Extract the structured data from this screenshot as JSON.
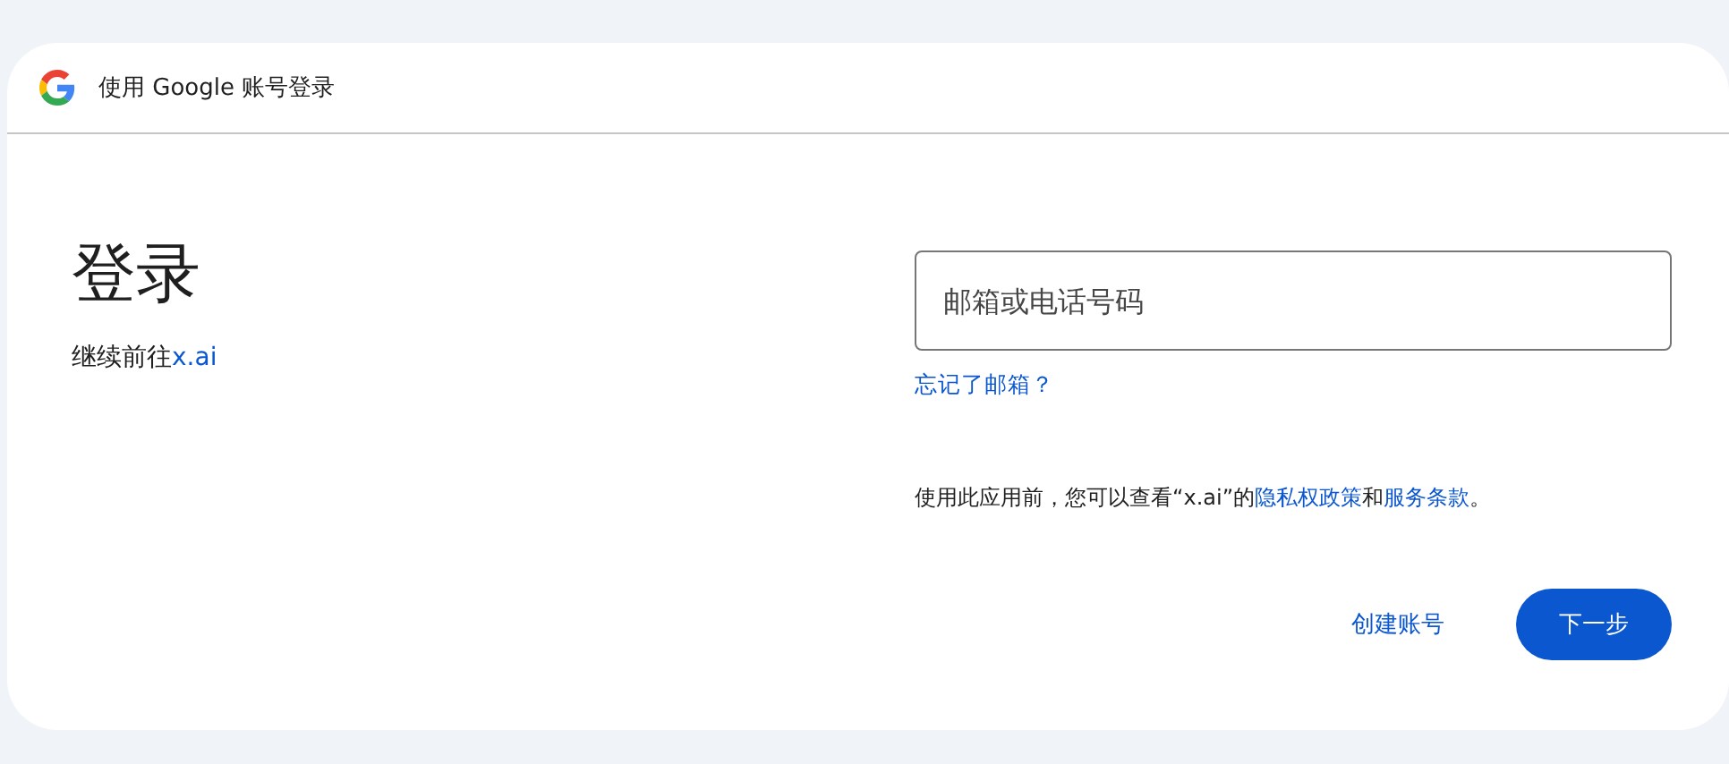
{
  "header": {
    "title": "使用 Google 账号登录"
  },
  "heading": "登录",
  "subtitle": [
    {
      "kind": "text",
      "text": "继续前往"
    },
    {
      "kind": "link",
      "text": "x.ai"
    }
  ],
  "email_field": {
    "placeholder": "邮箱或电话号码"
  },
  "forgot_link": "忘记了邮箱？",
  "notice": [
    {
      "kind": "text",
      "text": "使用此应用前，您可以查看“x.ai”的"
    },
    {
      "kind": "link",
      "text": "隐私权政策"
    },
    {
      "kind": "text",
      "text": "和"
    },
    {
      "kind": "link",
      "text": "服务条款"
    },
    {
      "kind": "text",
      "text": "。"
    }
  ],
  "buttons": [
    {
      "kind": "text",
      "label": "创建账号"
    },
    {
      "kind": "filled",
      "label": "下一步"
    }
  ]
}
